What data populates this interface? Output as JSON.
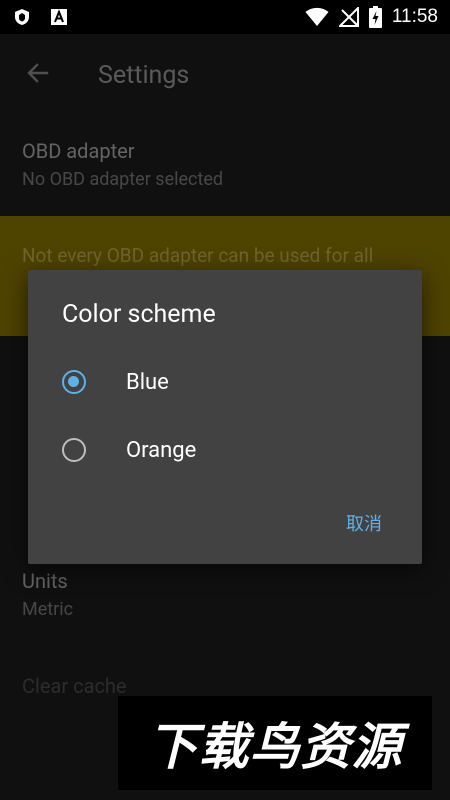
{
  "status_bar": {
    "time": "11:58",
    "left_icons": [
      "shield-icon",
      "a-box-icon"
    ],
    "right_icons": [
      "wifi-icon",
      "no-signal-icon",
      "battery-charging-icon"
    ]
  },
  "app_bar": {
    "back_icon": "arrow-back-icon",
    "title": "Settings"
  },
  "settings": {
    "obd_adapter": {
      "title": "OBD adapter",
      "summary": "No OBD adapter selected"
    },
    "warning_text": "Not every OBD adapter can be used for all",
    "units": {
      "title": "Units",
      "summary": "Metric"
    },
    "clear_cache": "Clear cache"
  },
  "dialog": {
    "title": "Color scheme",
    "options": [
      {
        "label": "Blue",
        "selected": true
      },
      {
        "label": "Orange",
        "selected": false
      }
    ],
    "cancel_label": "取消",
    "accent_color": "#5fb0e8"
  },
  "watermark": {
    "text": "下载鸟资源"
  }
}
